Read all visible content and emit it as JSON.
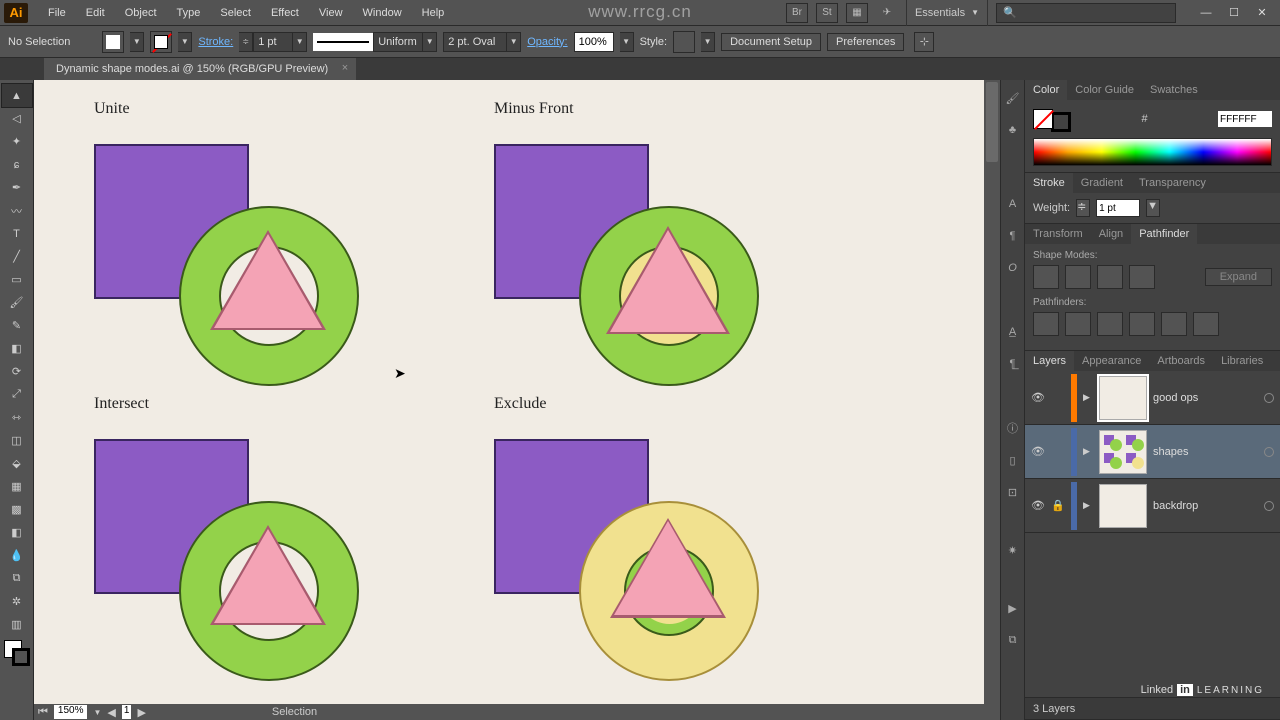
{
  "menubar": {
    "items": [
      "File",
      "Edit",
      "Object",
      "Type",
      "Select",
      "Effect",
      "View",
      "Window",
      "Help"
    ],
    "workspace": "Essentials",
    "search_placeholder": ""
  },
  "controlbar": {
    "selection": "No Selection",
    "stroke_label": "Stroke:",
    "stroke_weight": "1 pt",
    "stroke_profile": "Uniform",
    "brush": "2 pt. Oval",
    "opacity_label": "Opacity:",
    "opacity": "100%",
    "style_label": "Style:",
    "doc_setup": "Document Setup",
    "prefs": "Preferences"
  },
  "doc": {
    "tab": "Dynamic shape modes.ai @ 150% (RGB/GPU Preview)"
  },
  "canvas": {
    "q1": "Unite",
    "q2": "Minus Front",
    "q3": "Intersect",
    "q4": "Exclude"
  },
  "statusbar": {
    "zoom": "150%",
    "artboard_nav": "1",
    "tool": "Selection"
  },
  "panels": {
    "color": {
      "tabs": [
        "Color",
        "Color Guide",
        "Swatches"
      ],
      "hex_label": "#",
      "hex": "FFFFFF"
    },
    "stroke": {
      "tabs": [
        "Stroke",
        "Gradient",
        "Transparency"
      ],
      "weight_label": "Weight:",
      "weight": "1 pt"
    },
    "pathfinder": {
      "tabs": [
        "Transform",
        "Align",
        "Pathfinder"
      ],
      "modes_label": "Shape Modes:",
      "pf_label": "Pathfinders:",
      "expand": "Expand"
    },
    "layers": {
      "tabs": [
        "Layers",
        "Appearance",
        "Artboards",
        "Libraries"
      ],
      "rows": [
        {
          "name": "good ops",
          "color": "#ff7a00"
        },
        {
          "name": "shapes",
          "color": "#4a6aa8"
        },
        {
          "name": "backdrop",
          "color": "#4a6aa8"
        }
      ],
      "footer": "3 Layers"
    }
  },
  "watermark": "www.rrcg.cn",
  "brand": {
    "linked": "Linked",
    "in": "in",
    "learning": "LEARNING"
  }
}
